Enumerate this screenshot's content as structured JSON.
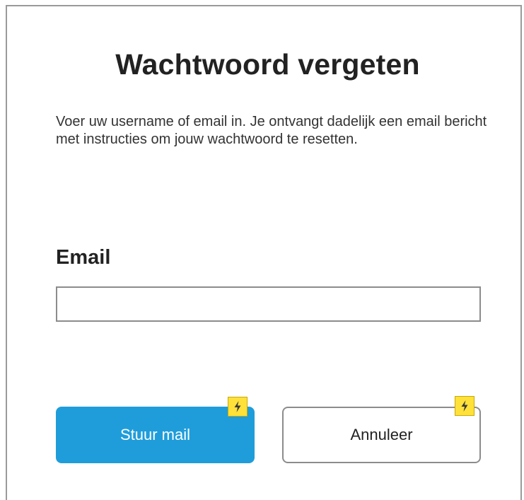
{
  "dialog": {
    "title": "Wachtwoord vergeten",
    "instructions": "Voer uw username of email in. Je ontvangt dadelijk een email bericht met instructies om jouw wachtwoord te resetten.",
    "email_label": "Email",
    "email_value": "",
    "submit_label": "Stuur mail",
    "cancel_label": "Annuleer"
  },
  "icons": {
    "submit_action": "lightning-bolt-icon",
    "cancel_action": "lightning-bolt-icon"
  },
  "colors": {
    "primary_button": "#1f9ddb",
    "action_badge": "#ffe13a"
  }
}
